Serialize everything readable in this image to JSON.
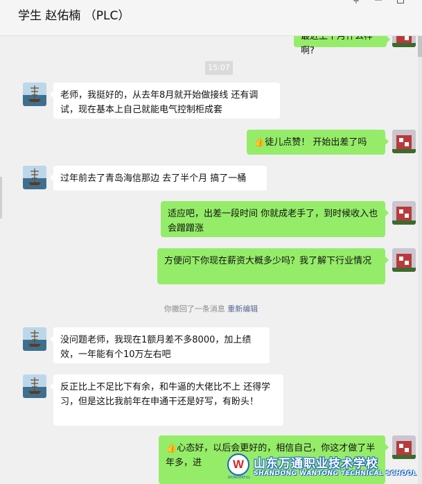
{
  "window": {
    "title": "学生 赵佑楠 （PLC）",
    "pin_icon": "pin-icon",
    "minimize_icon": "minimize-icon",
    "maximize_icon": "maximize-icon",
    "close_icon": "close-icon"
  },
  "chat": {
    "top_partial_message": "最近上个月什么样啊?",
    "timestamp": "15:07",
    "messages": [
      {
        "side": "left",
        "text": "老师，我挺好的，从去年8月就开始做接线 还有调试，现在基本上自己就能电气控制柜成套"
      },
      {
        "side": "right",
        "thumb": "👍",
        "text": "徒儿点赞！ 开始出差了吗"
      },
      {
        "side": "left",
        "text": "过年前去了青岛海信那边 去了半个月 搞了一桶"
      },
      {
        "side": "right",
        "text": "适应吧，出差一段时间  你就成老手了，到时候收入也会蹭蹭涨"
      },
      {
        "side": "right",
        "text": "方便问下你现在薪资大概多少吗？我了解下行业情况"
      },
      {
        "side": "left",
        "text": "没问题老师，我现在1额月差不多8000，加上绩效，一年能有个10万左右吧"
      },
      {
        "side": "left",
        "text": "反正比上不足比下有余，和牛逼的大佬比不上 还得学习，但是这比我前年在申通干还是好写，有盼头！"
      },
      {
        "side": "right",
        "thumb": "👍",
        "text": "心态好，以后会更好的，相信自己，你这才做了半年多，进"
      }
    ],
    "recall_notice": "你撤回了一条消息",
    "recall_action": "重新编辑"
  },
  "watermark": {
    "logo_letter": "W",
    "logo_caption": "WONDERFUL",
    "name": "山东万通职业技术学校",
    "subtitle": "SHANDONG WANTONG TECHNICAL SCHOOL"
  },
  "colors": {
    "sent_bubble": "#95ec69",
    "received_bubble": "#ffffff",
    "background": "#f0f0f0",
    "link": "#576b95"
  }
}
